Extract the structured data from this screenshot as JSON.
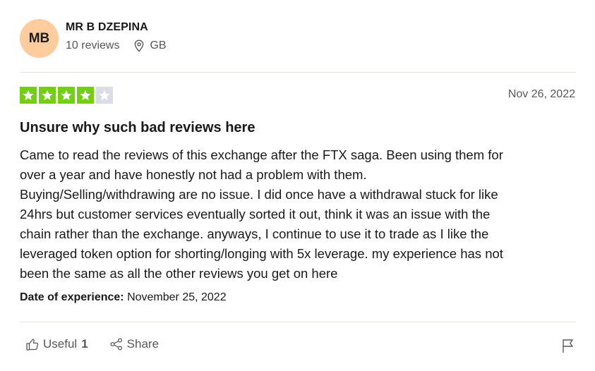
{
  "reviewer": {
    "initials": "MB",
    "name": "MR B DZEPINA",
    "reviews_count": "10 reviews",
    "country": "GB",
    "avatar_color": "#ffcc9e"
  },
  "review": {
    "rating": 4,
    "max_rating": 5,
    "star_color": "#73cf11",
    "date": "Nov 26, 2022",
    "title": "Unsure why such bad reviews here",
    "body_lines": [
      "Came to read the reviews of this exchange after the FTX saga. Been using them for",
      "over a year and have honestly not had a problem with them.",
      "Buying/Selling/withdrawing are no issue. I did once have a withdrawal stuck for like",
      "24hrs but customer services eventually sorted it out, think it was an issue with the",
      "chain rather than the exchange. anyways, I continue to use it to trade as I like the",
      "leveraged token option for shorting/longing with 5x leverage. my experience has not",
      "been the same as all the other reviews you get on here"
    ],
    "experience_label": "Date of experience:",
    "experience_date": "November 25, 2022"
  },
  "actions": {
    "useful_label": "Useful",
    "useful_count": "1",
    "share_label": "Share",
    "icons": [
      "thumbs-up-icon",
      "share-icon",
      "flag-icon",
      "location-pin-icon",
      "star-icon"
    ]
  }
}
